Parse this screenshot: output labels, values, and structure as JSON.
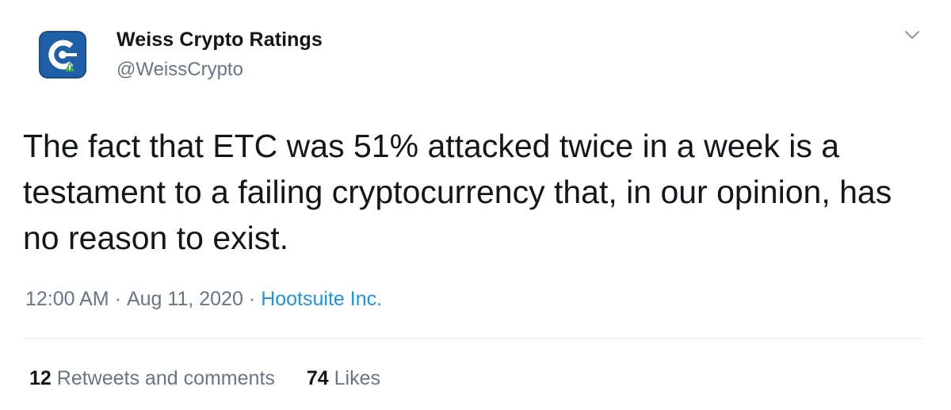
{
  "author": {
    "name": "Weiss Crypto Ratings",
    "handle": "@WeissCrypto",
    "avatar_icon": "weiss-crypto-logo-icon"
  },
  "tweet": {
    "text": "The fact that ETC was 51% attacked twice in a week is a testament to a failing cryptocurrency that, in our opinion, has no reason to exist."
  },
  "meta": {
    "time": "12:00 AM",
    "separator": "·",
    "date": "Aug 11, 2020",
    "source": "Hootsuite Inc."
  },
  "stats": {
    "retweets_count": "12",
    "retweets_label": "Retweets and comments",
    "likes_count": "74",
    "likes_label": "Likes"
  },
  "colors": {
    "text": "#14171a",
    "secondary": "#657786",
    "link": "#1b95e0",
    "avatar_bg": "#1f5fa8",
    "avatar_accent": "#3fae49"
  },
  "icons": {
    "more_menu": "chevron-down-icon"
  }
}
